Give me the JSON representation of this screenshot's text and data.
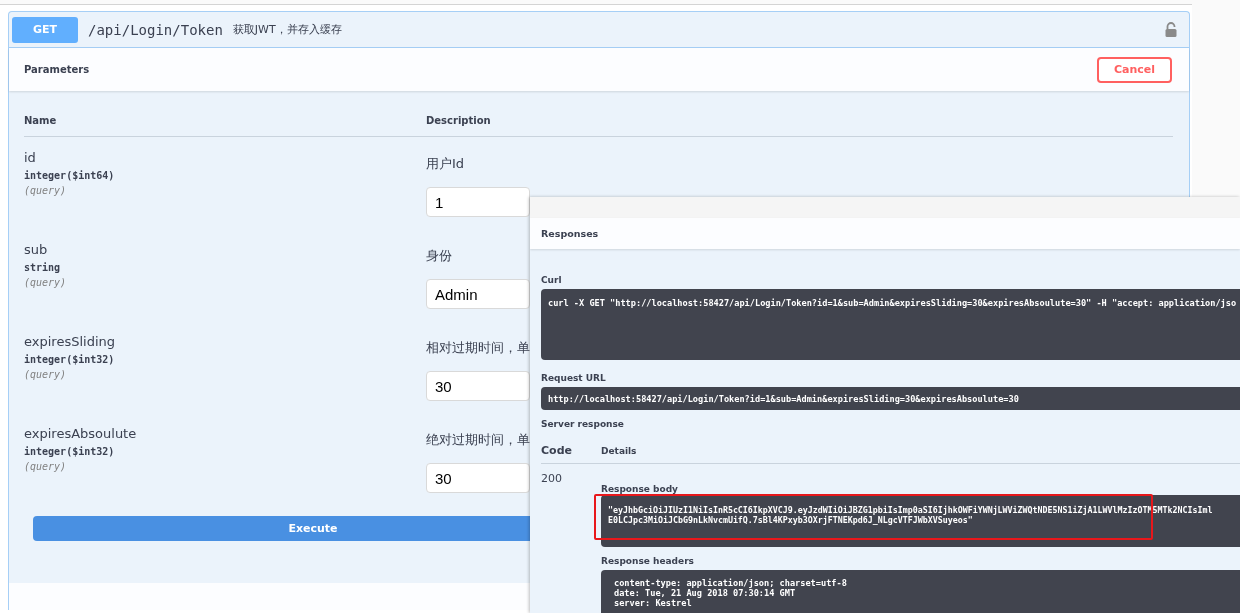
{
  "operation": {
    "method": "GET",
    "path": "/api/Login/Token",
    "summary": "获取JWT，并存入缓存"
  },
  "parameters": {
    "title": "Parameters",
    "cancel_button": "Cancel",
    "columns": [
      "Name",
      "Description"
    ],
    "rows": [
      {
        "name": "id",
        "type": "integer($int64)",
        "location": "(query)",
        "description": "用户Id",
        "value": "1"
      },
      {
        "name": "sub",
        "type": "string",
        "location": "(query)",
        "description": "身份",
        "value": "Admin"
      },
      {
        "name": "expiresSliding",
        "type": "integer($int32)",
        "location": "(query)",
        "description": "相对过期时间，单",
        "value": "30"
      },
      {
        "name": "expiresAbsoulute",
        "type": "integer($int32)",
        "location": "(query)",
        "description": "绝对过期时间，单",
        "value": "30"
      }
    ],
    "execute_button": "Execute"
  },
  "responses": {
    "title": "Responses",
    "curl_label": "Curl",
    "curl": "curl -X GET \"http://localhost:58427/api/Login/Token?id=1&sub=Admin&expiresSliding=30&expiresAbsoulute=30\" -H \"accept: application/jso",
    "request_url_label": "Request URL",
    "request_url": "http://localhost:58427/api/Login/Token?id=1&sub=Admin&expiresSliding=30&expiresAbsoulute=30",
    "server_response_label": "Server response",
    "columns": [
      "Code",
      "Details"
    ],
    "code": "200",
    "response_body_label": "Response body",
    "response_body": [
      "\"eyJhbGciOiJIUzI1NiIsInR5cCI6IkpXVCJ9.eyJzdWIiOiJBZG1pbiIsImp0aSI6IjhkOWFiYWNjLWViZWQtNDE5NS1iZjA1LWVlMzIzOTM5MTk2NCIsIml",
      "E0LCJpc3MiOiJCbG9nLkNvcmUifQ.7sBl4KPxyb3OXrjFTNEKpd6J_NLgcVTFJWbXVSuyeos\""
    ],
    "response_headers_label": "Response headers",
    "response_headers": [
      "content-type: application/json; charset=utf-8",
      "date: Tue, 21 Aug 2018 07:30:14 GMT",
      "server: Kestrel"
    ]
  }
}
